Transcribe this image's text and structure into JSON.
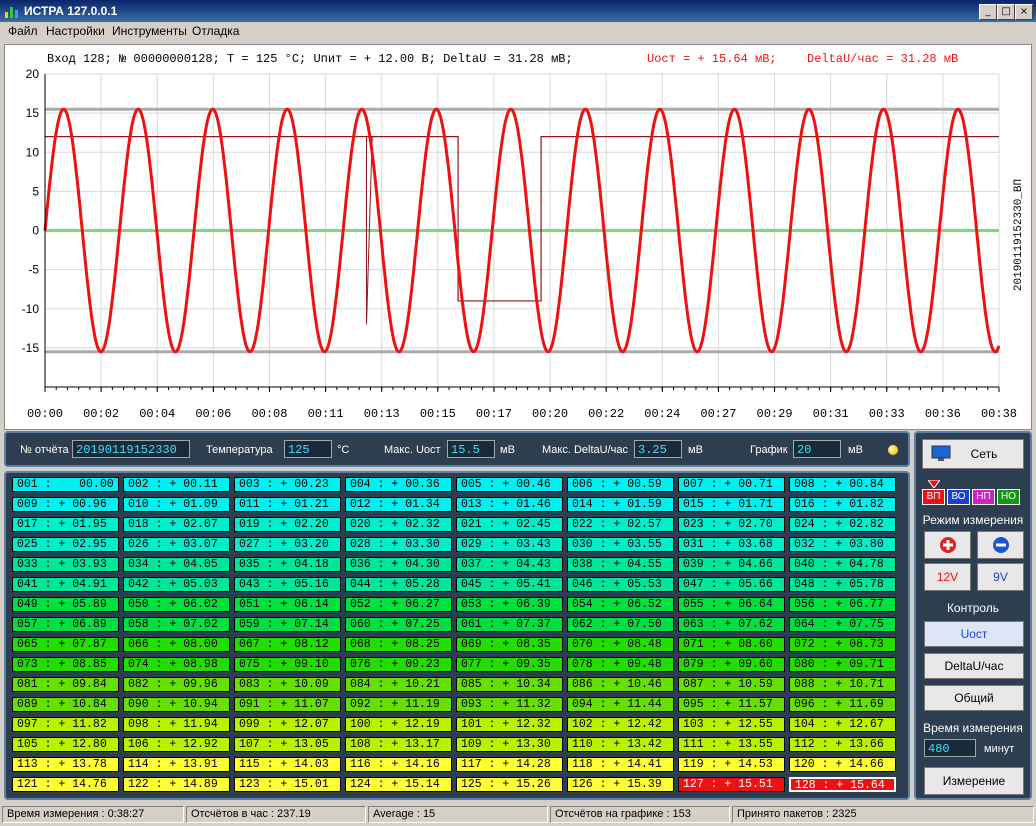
{
  "window": {
    "title": "ИСТРА  127.0.0.1"
  },
  "menu": [
    "Файл",
    "Настройки",
    "Инструменты",
    "Отладка"
  ],
  "chart_header": {
    "main": "Вход 128; № 00000000128; T = 125 °C; Uпит = + 12.00 В; DeltaU = 31.28 мВ;",
    "uost": "Uост = + 15.64 мВ;",
    "delta": "DeltaU/час = 31.28 мВ"
  },
  "chart_data": {
    "type": "line",
    "title": "Вход 128; № 00000000128; T = 125 °C; Uпит = + 12.00 В; DeltaU = 31.28 мВ; Uост = + 15.64 мВ; DeltaU/час = 31.28 мВ",
    "right_label": "20190119152330_ВП",
    "ylim": [
      -20,
      20
    ],
    "yticks": [
      20,
      15,
      10,
      5,
      0,
      -5,
      -10,
      -15
    ],
    "xticks": [
      "00:00",
      "00:02",
      "00:04",
      "00:06",
      "00:08",
      "00:11",
      "00:13",
      "00:15",
      "00:17",
      "00:20",
      "00:22",
      "00:24",
      "00:27",
      "00:29",
      "00:31",
      "00:33",
      "00:36",
      "00:38"
    ],
    "reference_lines": [
      15.5,
      -15.5,
      0
    ],
    "series": [
      {
        "color": "#ee1111",
        "amplitude": 15.5,
        "cycles": 12.8
      },
      {
        "color": "#8b1a1a",
        "levels": [
          {
            "from": 0,
            "to": 0.433,
            "y": 12
          },
          {
            "from": 0.433,
            "to": 0.52,
            "y": -9
          },
          {
            "from": 0.52,
            "to": 1,
            "y": 12
          }
        ]
      }
    ]
  },
  "info": {
    "report_label": "№ отчёта",
    "report": "20190119152330",
    "temp_label": "Температура",
    "temp": "125",
    "temp_unit": "°C",
    "uost_label": "Макс. Uост",
    "uost": "15.5",
    "uost_unit": "мВ",
    "delta_label": "Макс. DeltaU/час",
    "delta": "3.25",
    "delta_unit": "мВ",
    "graph_label": "График",
    "graph": "20",
    "graph_unit": "мВ"
  },
  "cells": [
    "001 :    00.00",
    "002 : + 00.11",
    "003 : + 00.23",
    "004 : + 00.36",
    "005 : + 00.46",
    "006 : + 00.59",
    "007 : + 00.71",
    "008 : + 00.84",
    "009 : + 00.96",
    "010 : + 01.09",
    "011 : + 01.21",
    "012 : + 01.34",
    "013 : + 01.46",
    "014 : + 01.59",
    "015 : + 01.71",
    "016 : + 01.82",
    "017 : + 01.95",
    "018 : + 02.07",
    "019 : + 02.20",
    "020 : + 02.32",
    "021 : + 02.45",
    "022 : + 02.57",
    "023 : + 02.70",
    "024 : + 02.82",
    "025 : + 02.95",
    "026 : + 03.07",
    "027 : + 03.20",
    "028 : + 03.30",
    "029 : + 03.43",
    "030 : + 03.55",
    "031 : + 03.68",
    "032 : + 03.80",
    "033 : + 03.93",
    "034 : + 04.05",
    "035 : + 04.18",
    "036 : + 04.30",
    "037 : + 04.43",
    "038 : + 04.55",
    "039 : + 04.66",
    "040 : + 04.78",
    "041 : + 04.91",
    "042 : + 05.03",
    "043 : + 05.16",
    "044 : + 05.28",
    "045 : + 05.41",
    "046 : + 05.53",
    "047 : + 05.66",
    "048 : + 05.78",
    "049 : + 05.89",
    "050 : + 06.02",
    "051 : + 06.14",
    "052 : + 06.27",
    "053 : + 06.39",
    "054 : + 06.52",
    "055 : + 06.64",
    "056 : + 06.77",
    "057 : + 06.89",
    "058 : + 07.02",
    "059 : + 07.14",
    "060 : + 07.25",
    "061 : + 07.37",
    "062 : + 07.50",
    "063 : + 07.62",
    "064 : + 07.75",
    "065 : + 07.87",
    "066 : + 08.00",
    "067 : + 08.12",
    "068 : + 08.25",
    "069 : + 08.35",
    "070 : + 08.48",
    "071 : + 08.60",
    "072 : + 08.73",
    "073 : + 08.85",
    "074 : + 08.98",
    "075 : + 09.10",
    "076 : + 09.23",
    "077 : + 09.35",
    "078 : + 09.48",
    "079 : + 09.60",
    "080 : + 09.71",
    "081 : + 09.84",
    "082 : + 09.96",
    "083 : + 10.09",
    "084 : + 10.21",
    "085 : + 10.34",
    "086 : + 10.46",
    "087 : + 10.59",
    "088 : + 10.71",
    "089 : + 10.84",
    "090 : + 10.94",
    "091 : + 11.07",
    "092 : + 11.19",
    "093 : + 11.32",
    "094 : + 11.44",
    "095 : + 11.57",
    "096 : + 11.69",
    "097 : + 11.82",
    "098 : + 11.94",
    "099 : + 12.07",
    "100 : + 12.19",
    "101 : + 12.32",
    "102 : + 12.42",
    "103 : + 12.55",
    "104 : + 12.67",
    "105 : + 12.80",
    "106 : + 12.92",
    "107 : + 13.05",
    "108 : + 13.17",
    "109 : + 13.30",
    "110 : + 13.42",
    "111 : + 13.55",
    "112 : + 13.66",
    "113 : + 13.78",
    "114 : + 13.91",
    "115 : + 14.03",
    "116 : + 14.16",
    "117 : + 14.28",
    "118 : + 14.41",
    "119 : + 14.53",
    "120 : + 14.66",
    "121 : + 14.76",
    "122 : + 14.89",
    "123 : + 15.01",
    "124 : + 15.14",
    "125 : + 15.26",
    "126 : + 15.39",
    "127 : + 15.51",
    "128 : + 15.64"
  ],
  "side": {
    "network": "Сеть",
    "modes": [
      "ВП",
      "ВО",
      "НП",
      "НО"
    ],
    "mode_label": "Режим измерения",
    "v12": "12V",
    "v9": "9V",
    "control_label": "Контроль",
    "btn_uost": "Uост",
    "btn_delta": "DeltaU/час",
    "btn_common": "Общий",
    "time_label": "Время измерения",
    "time_value": "480",
    "time_unit": "минут",
    "measure": "Измерение"
  },
  "status": [
    "Время измерения : 0:38:27",
    "Отсчётов в час : 237.19",
    "Average : 15",
    "Отсчётов на графике : 153",
    "Принято пакетов : 2325"
  ]
}
